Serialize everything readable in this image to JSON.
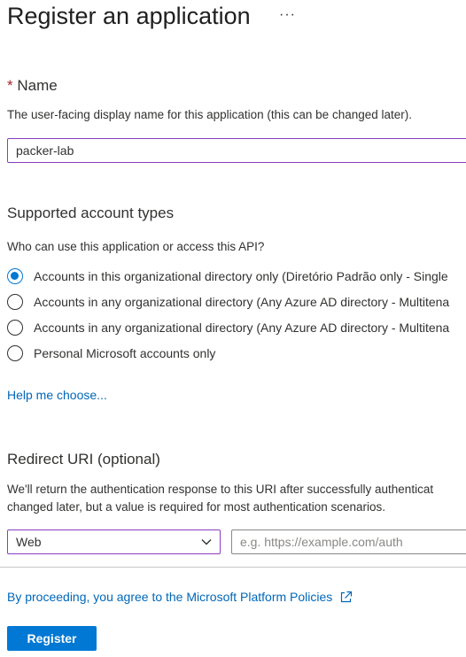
{
  "page": {
    "title": "Register an application",
    "more_icon": "ellipsis-icon",
    "more": "···"
  },
  "name_section": {
    "required_marker": "*",
    "label": "Name",
    "description": "The user-facing display name for this application (this can be changed later).",
    "value": "packer-lab"
  },
  "account_types": {
    "heading": "Supported account types",
    "question": "Who can use this application or access this API?",
    "options": [
      {
        "label": "Accounts in this organizational directory only (Diretório Padrão only - Single",
        "selected": true
      },
      {
        "label": "Accounts in any organizational directory (Any Azure AD directory - Multitena",
        "selected": false
      },
      {
        "label": "Accounts in any organizational directory (Any Azure AD directory - Multitena",
        "selected": false
      },
      {
        "label": "Personal Microsoft accounts only",
        "selected": false
      }
    ],
    "help_link": "Help me choose..."
  },
  "redirect": {
    "heading": "Redirect URI (optional)",
    "description_line1": "We'll return the authentication response to this URI after successfully authenticat",
    "description_line2": "changed later, but a value is required for most authentication scenarios.",
    "platform_value": "Web",
    "uri_placeholder": "e.g. https://example.com/auth"
  },
  "footer": {
    "policy_text": "By proceeding, you agree to the Microsoft Platform Policies",
    "external_icon": "external-link-icon",
    "register_label": "Register"
  },
  "colors": {
    "accent": "#0078d4",
    "link": "#0067b8",
    "input_focus_border": "#8a3cc0",
    "required": "#a4262c"
  }
}
